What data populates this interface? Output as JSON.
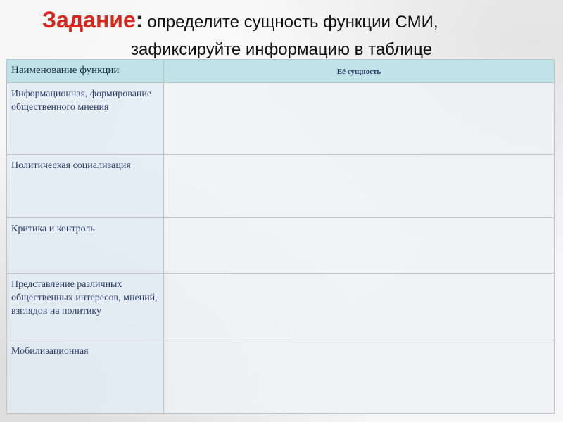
{
  "title": {
    "task_label": "Задание",
    "colon": ":",
    "line1_rest": "определите сущность функции СМИ,",
    "line2": "зафиксируйте информацию в таблице"
  },
  "table": {
    "headers": [
      "Наименование функции",
      "Её сущность"
    ],
    "rows": [
      {
        "name": "Информационная, формирование общественного мнения",
        "essence": ""
      },
      {
        "name": "Политическая социализация",
        "essence": ""
      },
      {
        "name": "Критика и контроль",
        "essence": ""
      },
      {
        "name": "Представление различных общественных интересов, мнений, взглядов на политику",
        "essence": ""
      },
      {
        "name": "Мобилизационная",
        "essence": ""
      }
    ]
  }
}
